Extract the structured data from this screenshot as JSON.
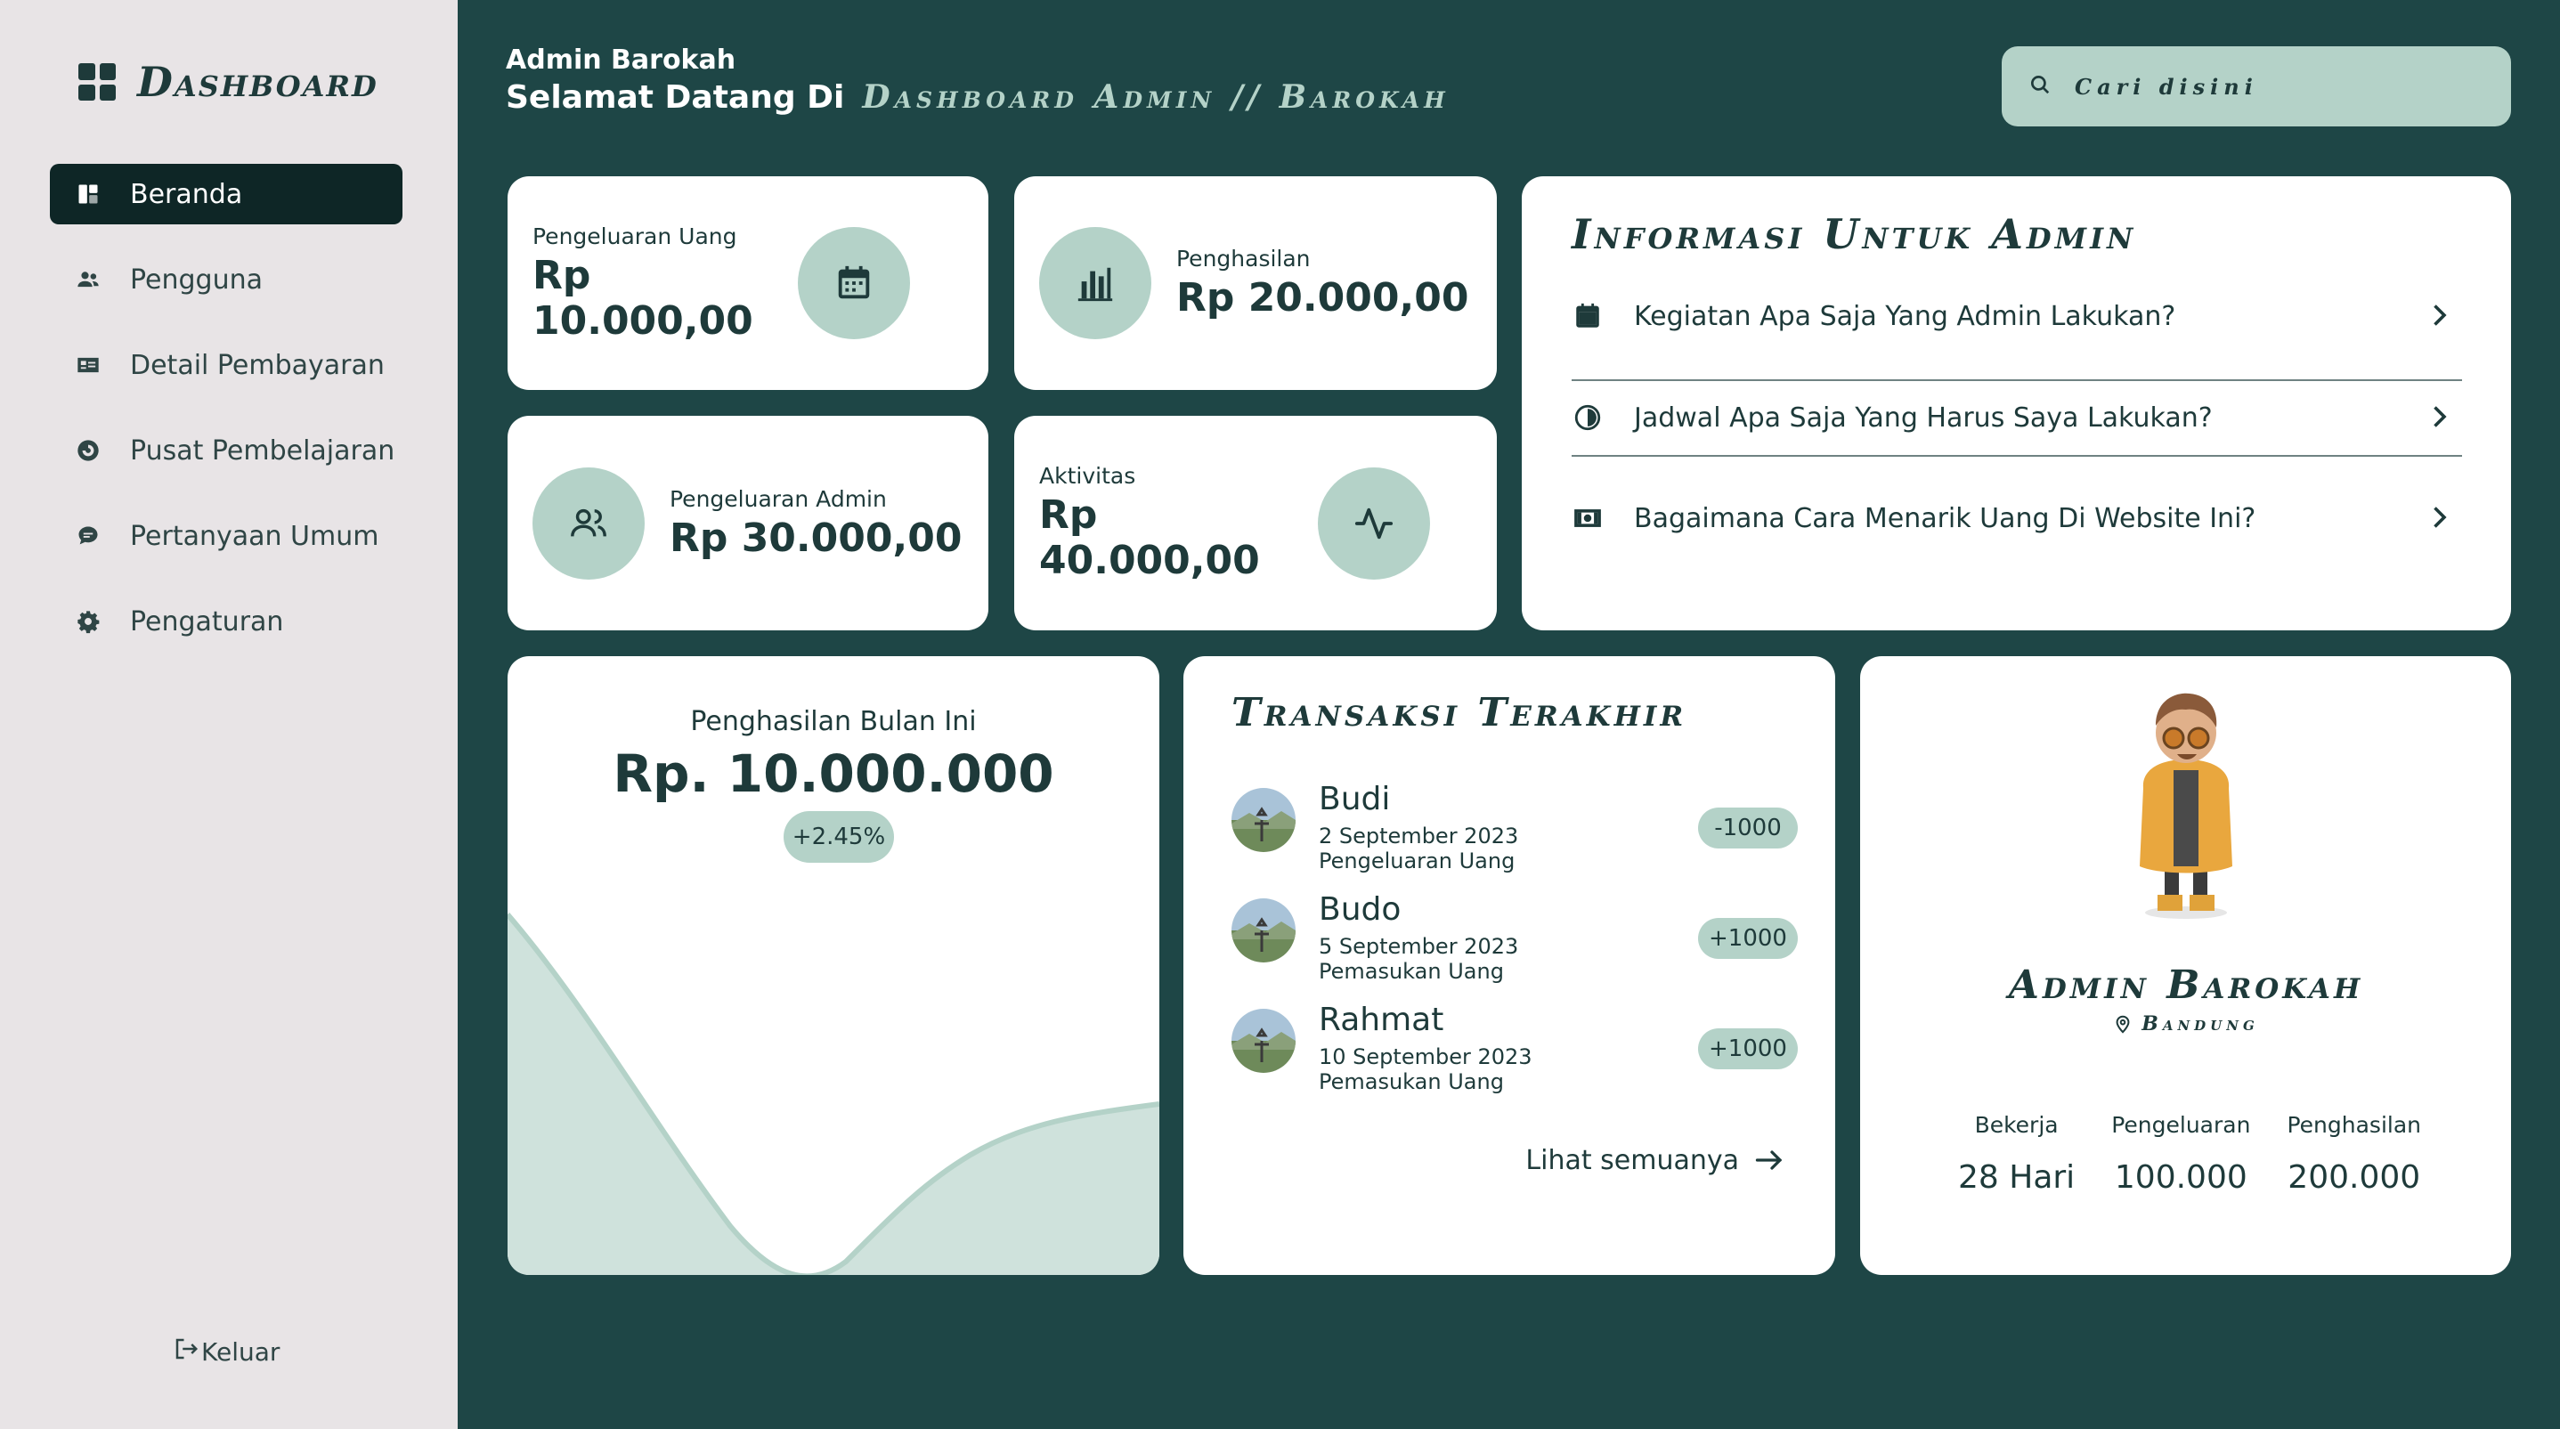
{
  "sidebar": {
    "brand": "Dashboard",
    "items": [
      {
        "label": "Beranda",
        "icon": "home-icon"
      },
      {
        "label": "Pengguna",
        "icon": "users-icon"
      },
      {
        "label": "Detail Pembayaran",
        "icon": "id-card-icon"
      },
      {
        "label": "Pusat Pembelajaran",
        "icon": "learning-icon"
      },
      {
        "label": "Pertanyaan Umum",
        "icon": "chat-icon"
      },
      {
        "label": "Pengaturan",
        "icon": "gear-icon"
      }
    ],
    "logout_label": "Keluar"
  },
  "header": {
    "user_name": "Admin Barokah",
    "welcome_prefix": "Selamat Datang Di",
    "welcome_site": "Dashboard Admin // Barokah"
  },
  "search": {
    "placeholder": "Cari disini"
  },
  "stats": [
    {
      "label": "Pengeluaran Uang",
      "value": "Rp 10.000,00",
      "icon": "calendar-icon"
    },
    {
      "label": "Penghasilan",
      "value": "Rp 20.000,00",
      "icon": "bar-chart-icon"
    },
    {
      "label": "Pengeluaran Admin",
      "value": "Rp 30.000,00",
      "icon": "users-icon"
    },
    {
      "label": "Aktivitas",
      "value": "Rp 40.000,00",
      "icon": "activity-icon"
    }
  ],
  "info": {
    "title": "Informasi Untuk Admin",
    "items": [
      {
        "text": "Kegiatan Apa Saja Yang Admin Lakukan?",
        "icon": "calendar-icon"
      },
      {
        "text": "Jadwal Apa Saja Yang Harus Saya Lakukan?",
        "icon": "clock-icon"
      },
      {
        "text": "Bagaimana Cara Menarik Uang Di Website Ini?",
        "icon": "money-icon"
      }
    ]
  },
  "income": {
    "title": "Penghasilan Bulan Ini",
    "value": "Rp. 10.000.000",
    "change": "+2.45%"
  },
  "transactions": {
    "title": "Transaksi Terakhir",
    "rows": [
      {
        "name": "Budi",
        "date": "2 September 2023",
        "type": "Pengeluaran Uang",
        "amount": "-1000"
      },
      {
        "name": "Budo",
        "date": "5 September 2023",
        "type": "Pemasukan Uang",
        "amount": "+1000"
      },
      {
        "name": "Rahmat",
        "date": "10 September 2023",
        "type": "Pemasukan Uang",
        "amount": "+1000"
      }
    ],
    "see_all": "Lihat semuanya"
  },
  "profile": {
    "name": "Admin Barokah",
    "location": "Bandung",
    "stats": [
      {
        "label": "Bekerja",
        "value": "28 Hari"
      },
      {
        "label": "Pengeluaran",
        "value": "100.000"
      },
      {
        "label": "Penghasilan",
        "value": "200.000"
      }
    ]
  },
  "colors": {
    "background": "#1e4646",
    "sidebar": "#e8e4e6",
    "accent": "#b4d2c8",
    "active_nav": "#0e2626",
    "text_dark": "#1e3a3a"
  }
}
